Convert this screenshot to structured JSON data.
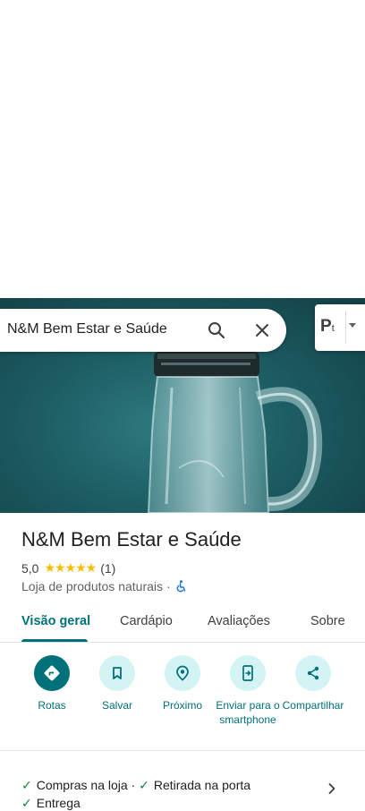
{
  "search": {
    "query": "N&M Bem Estar e Saúde"
  },
  "layers": {
    "label": "P",
    "sub": "t"
  },
  "place": {
    "name": "N&M Bem Estar e Saúde",
    "rating": "5,0",
    "stars": "★★★★★",
    "reviews": "(1)",
    "category": "Loja de produtos naturais",
    "separator": "·"
  },
  "tabs": [
    {
      "label": "Visão geral"
    },
    {
      "label": "Cardápio"
    },
    {
      "label": "Avaliações"
    },
    {
      "label": "Sobre"
    }
  ],
  "actions": [
    {
      "label": "Rotas",
      "icon": "directions-icon"
    },
    {
      "label": "Salvar",
      "icon": "bookmark-icon"
    },
    {
      "label": "Próximo",
      "icon": "nearby-icon"
    },
    {
      "label": "Enviar para o smartphone",
      "icon": "send-to-phone-icon"
    },
    {
      "label": "Compartilhar",
      "icon": "share-icon"
    }
  ],
  "services": [
    {
      "label": "Compras na loja",
      "suffix": " · "
    },
    {
      "label": "Retirada na porta",
      "suffix": ""
    },
    {
      "label": "Entrega",
      "suffix": ""
    }
  ],
  "colors": {
    "accent": "#00707a",
    "accent_light": "#d4f3f5",
    "star": "#fbbc04",
    "check": "#188038"
  }
}
